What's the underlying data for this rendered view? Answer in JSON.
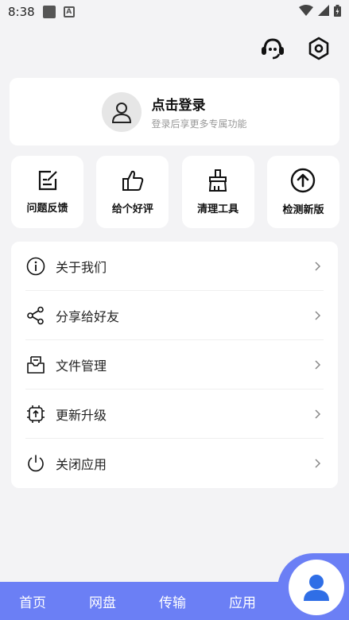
{
  "status_bar": {
    "time": "8:38",
    "a_badge": "A"
  },
  "login": {
    "title": "点击登录",
    "subtitle": "登录后享更多专属功能"
  },
  "quick_actions": [
    {
      "label": "问题反馈",
      "icon": "feedback-icon"
    },
    {
      "label": "给个好评",
      "icon": "thumbs-up-icon"
    },
    {
      "label": "清理工具",
      "icon": "broom-icon"
    },
    {
      "label": "检测新版",
      "icon": "arrow-up-circle-icon"
    }
  ],
  "menu": [
    {
      "label": "关于我们",
      "icon": "info-icon"
    },
    {
      "label": "分享给好友",
      "icon": "share-icon"
    },
    {
      "label": "文件管理",
      "icon": "folder-icon"
    },
    {
      "label": "更新升级",
      "icon": "upgrade-icon"
    },
    {
      "label": "关闭应用",
      "icon": "power-icon"
    }
  ],
  "tabs": [
    {
      "label": "首页"
    },
    {
      "label": "网盘"
    },
    {
      "label": "传输"
    },
    {
      "label": "应用"
    }
  ],
  "colors": {
    "accent": "#6b7ff5",
    "fab_icon": "#2f6ee6"
  }
}
